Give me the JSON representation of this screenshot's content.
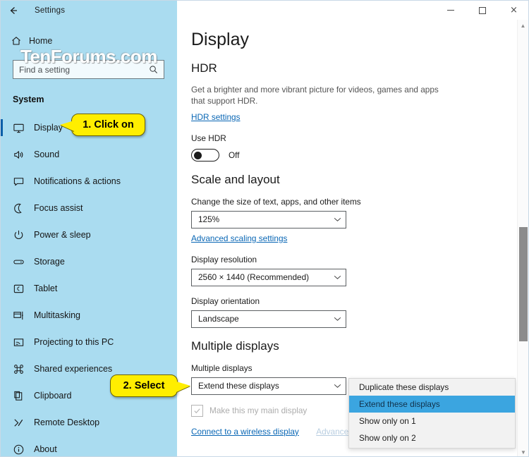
{
  "window": {
    "title": "Settings",
    "back_icon": "back-arrow-icon",
    "controls": {
      "minimize": "minimize-icon",
      "maximize": "maximize-icon",
      "close": "×"
    }
  },
  "sidebar": {
    "home_label": "Home",
    "home_icon": "home-icon",
    "search": {
      "placeholder": "Find a setting",
      "value": "",
      "icon": "search-icon"
    },
    "section_title": "System",
    "items": [
      {
        "label": "Display",
        "icon": "monitor-icon",
        "selected": true
      },
      {
        "label": "Sound",
        "icon": "speaker-icon",
        "selected": false
      },
      {
        "label": "Notifications & actions",
        "icon": "chat-icon",
        "selected": false
      },
      {
        "label": "Focus assist",
        "icon": "moon-icon",
        "selected": false
      },
      {
        "label": "Power & sleep",
        "icon": "power-icon",
        "selected": false
      },
      {
        "label": "Storage",
        "icon": "drive-icon",
        "selected": false
      },
      {
        "label": "Tablet",
        "icon": "tablet-icon",
        "selected": false
      },
      {
        "label": "Multitasking",
        "icon": "multitask-icon",
        "selected": false
      },
      {
        "label": "Projecting to this PC",
        "icon": "project-icon",
        "selected": false
      },
      {
        "label": "Shared experiences",
        "icon": "command-icon",
        "selected": false
      },
      {
        "label": "Clipboard",
        "icon": "clipboard-icon",
        "selected": false
      },
      {
        "label": "Remote Desktop",
        "icon": "remote-icon",
        "selected": false
      },
      {
        "label": "About",
        "icon": "info-icon",
        "selected": false
      }
    ]
  },
  "main": {
    "page_title": "Display",
    "hdr": {
      "heading": "HDR",
      "description": "Get a brighter and more vibrant picture for videos, games and apps that support HDR.",
      "settings_link": "HDR settings",
      "toggle_label": "Use HDR",
      "toggle_state": "Off"
    },
    "scale_and_layout": {
      "heading": "Scale and layout",
      "scale_label": "Change the size of text, apps, and other items",
      "scale_value": "125%",
      "advanced_link": "Advanced scaling settings",
      "resolution_label": "Display resolution",
      "resolution_value": "2560 × 1440 (Recommended)",
      "orientation_label": "Display orientation",
      "orientation_value": "Landscape"
    },
    "multiple_displays": {
      "heading": "Multiple displays",
      "field_label": "Multiple displays",
      "selected_value": "Extend these displays",
      "options": [
        "Duplicate these displays",
        "Extend these displays",
        "Show only on 1",
        "Show only on 2"
      ],
      "highlighted_option": "Extend these displays",
      "checkbox_label": "Make this my main display",
      "checkbox_checked": true,
      "wireless_link": "Connect to a wireless display",
      "advanced_display_link": "Advanced display settings"
    }
  },
  "callouts": [
    {
      "text": "1. Click on"
    },
    {
      "text": "2. Select"
    }
  ],
  "watermark": "TenForums.com",
  "colors": {
    "sidebar_bg": "#aadcf0",
    "accent_selected": "#0a5ea8",
    "link": "#0a67b5",
    "dropdown_highlight": "#3ba5e0",
    "callout_bg": "#ffee00"
  },
  "scrollbar": {
    "up_arrow": "▲",
    "down_arrow": "▼"
  }
}
